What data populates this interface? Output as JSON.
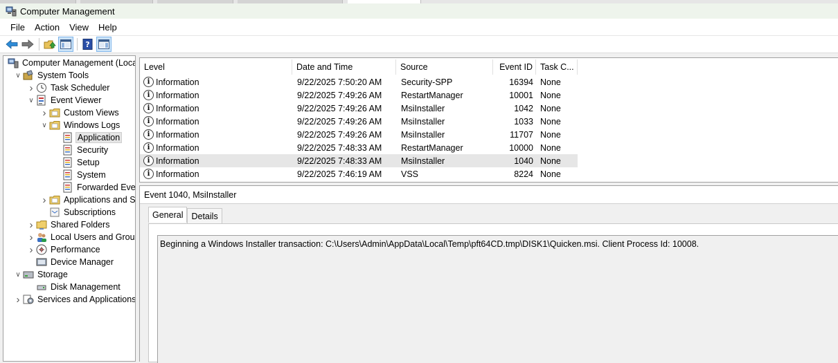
{
  "window": {
    "title": "Computer Management"
  },
  "menu": [
    "File",
    "Action",
    "View",
    "Help"
  ],
  "toolbar": [
    "back-icon",
    "forward-icon",
    "up-folder-icon",
    "show-hide-tree-icon",
    "help-icon",
    "show-hide-action-pane-icon"
  ],
  "tree": [
    {
      "label": "Computer Management (Local",
      "icon": "computer-management-icon",
      "level": 0,
      "chevron": ""
    },
    {
      "label": "System Tools",
      "icon": "system-tools-icon",
      "level": 1,
      "chevron": "expanded"
    },
    {
      "label": "Task Scheduler",
      "icon": "clock-icon",
      "level": 2,
      "chevron": "collapsed"
    },
    {
      "label": "Event Viewer",
      "icon": "event-viewer-icon",
      "level": 2,
      "chevron": "expanded"
    },
    {
      "label": "Custom Views",
      "icon": "folder-icon",
      "level": 3,
      "chevron": "collapsed"
    },
    {
      "label": "Windows Logs",
      "icon": "folder-icon",
      "level": 3,
      "chevron": "expanded"
    },
    {
      "label": "Application",
      "icon": "log-icon",
      "level": 4,
      "chevron": "",
      "selected": true
    },
    {
      "label": "Security",
      "icon": "log-icon",
      "level": 4,
      "chevron": ""
    },
    {
      "label": "Setup",
      "icon": "log-icon",
      "level": 4,
      "chevron": ""
    },
    {
      "label": "System",
      "icon": "log-icon",
      "level": 4,
      "chevron": ""
    },
    {
      "label": "Forwarded Event",
      "icon": "log-icon",
      "level": 4,
      "chevron": ""
    },
    {
      "label": "Applications and Se",
      "icon": "folder-icon",
      "level": 3,
      "chevron": "collapsed"
    },
    {
      "label": "Subscriptions",
      "icon": "subscriptions-icon",
      "level": 3,
      "chevron": ""
    },
    {
      "label": "Shared Folders",
      "icon": "shared-folder-icon",
      "level": 2,
      "chevron": "collapsed"
    },
    {
      "label": "Local Users and Groups",
      "icon": "users-icon",
      "level": 2,
      "chevron": "collapsed"
    },
    {
      "label": "Performance",
      "icon": "performance-icon",
      "level": 2,
      "chevron": "collapsed"
    },
    {
      "label": "Device Manager",
      "icon": "device-manager-icon",
      "level": 2,
      "chevron": ""
    },
    {
      "label": "Storage",
      "icon": "storage-icon",
      "level": 1,
      "chevron": "expanded"
    },
    {
      "label": "Disk Management",
      "icon": "disk-icon",
      "level": 2,
      "chevron": ""
    },
    {
      "label": "Services and Applications",
      "icon": "services-icon",
      "level": 1,
      "chevron": "collapsed"
    }
  ],
  "list": {
    "columns": [
      "Level",
      "Date and Time",
      "Source",
      "Event ID",
      "Task C..."
    ],
    "rows": [
      {
        "level": "Information",
        "datetime": "9/22/2025 7:50:20 AM",
        "source": "Security-SPP",
        "event_id": "16394",
        "task": "None"
      },
      {
        "level": "Information",
        "datetime": "9/22/2025 7:49:26 AM",
        "source": "RestartManager",
        "event_id": "10001",
        "task": "None"
      },
      {
        "level": "Information",
        "datetime": "9/22/2025 7:49:26 AM",
        "source": "MsiInstaller",
        "event_id": "1042",
        "task": "None"
      },
      {
        "level": "Information",
        "datetime": "9/22/2025 7:49:26 AM",
        "source": "MsiInstaller",
        "event_id": "1033",
        "task": "None"
      },
      {
        "level": "Information",
        "datetime": "9/22/2025 7:49:26 AM",
        "source": "MsiInstaller",
        "event_id": "11707",
        "task": "None"
      },
      {
        "level": "Information",
        "datetime": "9/22/2025 7:48:33 AM",
        "source": "RestartManager",
        "event_id": "10000",
        "task": "None"
      },
      {
        "level": "Information",
        "datetime": "9/22/2025 7:48:33 AM",
        "source": "MsiInstaller",
        "event_id": "1040",
        "task": "None",
        "selected": true
      },
      {
        "level": "Information",
        "datetime": "9/22/2025 7:46:19 AM",
        "source": "VSS",
        "event_id": "8224",
        "task": "None"
      }
    ]
  },
  "detail": {
    "title": "Event 1040, MsiInstaller",
    "tabs": [
      "General",
      "Details"
    ],
    "active_tab": "General",
    "message": "Beginning a Windows Installer transaction: C:\\Users\\Admin\\AppData\\Local\\Temp\\pft64CD.tmp\\DISK1\\Quicken.msi. Client Process Id: 10008."
  }
}
